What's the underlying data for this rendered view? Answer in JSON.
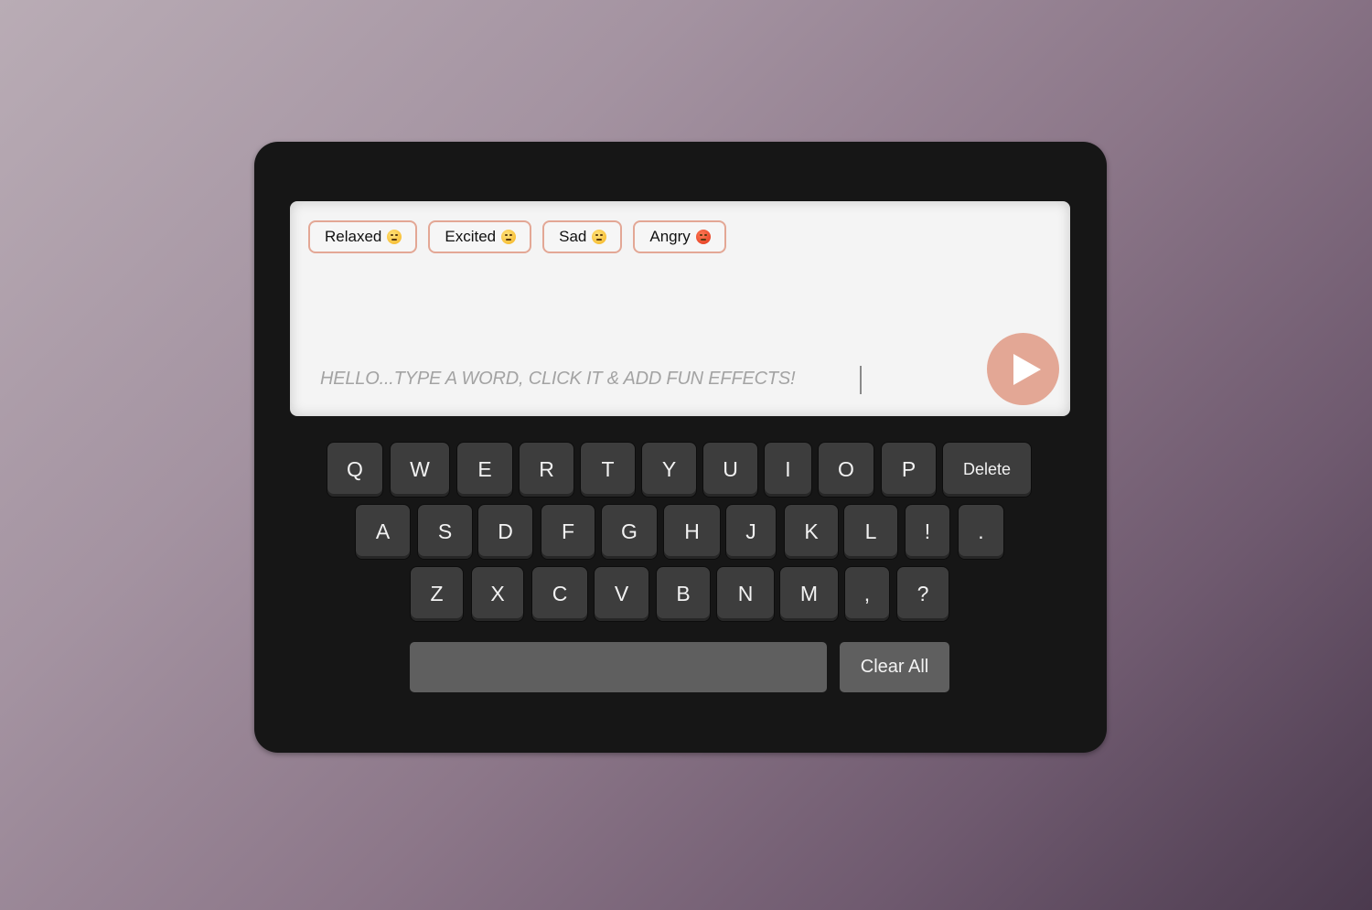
{
  "moods": [
    {
      "label": "Relaxed",
      "emoji_icon": "relieved-face-icon",
      "emoji_color": "#f5b31f"
    },
    {
      "label": "Excited",
      "emoji_icon": "grinning-face-icon",
      "emoji_color": "#f5b31f"
    },
    {
      "label": "Sad",
      "emoji_icon": "pensive-face-icon",
      "emoji_color": "#f5b31f"
    },
    {
      "label": "Angry",
      "emoji_icon": "angry-face-icon",
      "emoji_color": "#e0341a"
    }
  ],
  "input": {
    "placeholder": "HELLO...TYPE A WORD, CLICK IT & ADD FUN EFFECTS!"
  },
  "play_button": {
    "icon": "play-icon"
  },
  "keyboard": {
    "row1": [
      "Q",
      "W",
      "E",
      "R",
      "T",
      "Y",
      "U",
      "I",
      "O",
      "P",
      "Delete"
    ],
    "row2": [
      "A",
      "S",
      "D",
      "F",
      "G",
      "H",
      "J",
      "K",
      "L",
      "!",
      "."
    ],
    "row3": [
      "Z",
      "X",
      "C",
      "V",
      "B",
      "N",
      "M",
      ",",
      "?"
    ],
    "space_label": "",
    "clear_label": "Clear All"
  },
  "colors": {
    "accent": "#e3a795",
    "device": "#161616",
    "screen": "#f4f4f4",
    "key": "#3d3d3d",
    "wide_key": "#5f5f5f"
  }
}
